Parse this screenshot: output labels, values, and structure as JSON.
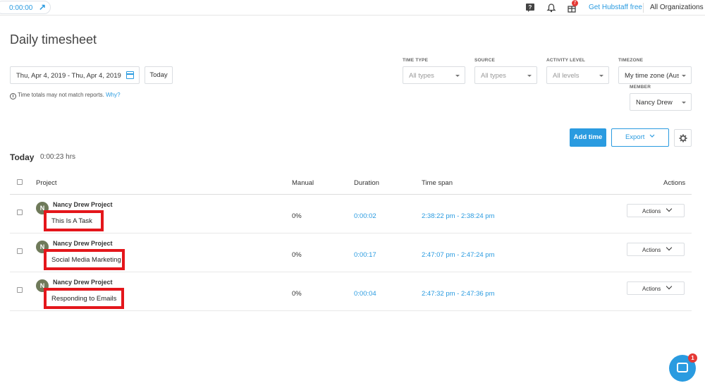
{
  "topbar": {
    "timer": "0:00:00",
    "gift_badge": "7",
    "hubstaff_link": "Get Hubstaff free",
    "organization": "All Organizations"
  },
  "page_title": "Daily timesheet",
  "date_range": {
    "value": "Thu, Apr 4, 2019 - Thu, Apr 4, 2019",
    "today_label": "Today"
  },
  "note": {
    "text": "Time totals may not match reports.",
    "link": "Why?"
  },
  "filters": {
    "time_type": {
      "label": "TIME TYPE",
      "value": "All types"
    },
    "source": {
      "label": "SOURCE",
      "value": "All types"
    },
    "activity_level": {
      "label": "ACTIVITY LEVEL",
      "value": "All levels"
    },
    "timezone": {
      "label": "TIMEZONE",
      "value": "My time zone (Austi"
    },
    "member": {
      "label": "MEMBER",
      "value": "Nancy Drew"
    }
  },
  "actions": {
    "add_time": "Add time",
    "export": "Export"
  },
  "summary": {
    "label": "Today",
    "hours": "0:00:23 hrs"
  },
  "table": {
    "headers": {
      "project": "Project",
      "manual": "Manual",
      "duration": "Duration",
      "time_span": "Time span",
      "actions": "Actions"
    },
    "rows": [
      {
        "avatar": "N",
        "project": "Nancy Drew Project",
        "task": "This Is A Task",
        "manual": "0%",
        "duration": "0:00:02",
        "time_span": "2:38:22 pm - 2:38:24 pm",
        "action": "Actions"
      },
      {
        "avatar": "N",
        "project": "Nancy Drew Project",
        "task": "Social Media Marketing",
        "manual": "0%",
        "duration": "0:00:17",
        "time_span": "2:47:07 pm - 2:47:24 pm",
        "action": "Actions"
      },
      {
        "avatar": "N",
        "project": "Nancy Drew Project",
        "task": "Responding to Emails",
        "manual": "0%",
        "duration": "0:00:04",
        "time_span": "2:47:32 pm - 2:47:36 pm",
        "action": "Actions"
      }
    ]
  },
  "chat": {
    "badge": "1"
  },
  "colors": {
    "accent": "#2a9be0",
    "highlight": "#e4161b",
    "badge": "#e53935"
  }
}
